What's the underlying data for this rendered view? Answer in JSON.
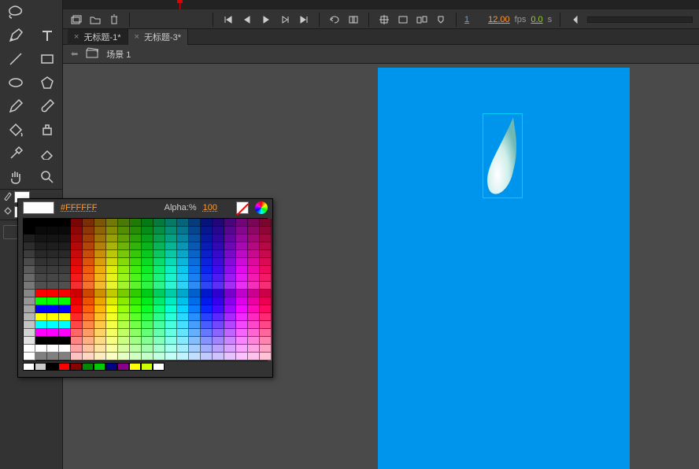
{
  "playback": {
    "frame": "1",
    "fps_value": "12.00",
    "fps_label": "fps",
    "time_value": "0.0",
    "time_label": "s"
  },
  "tabs": [
    {
      "label": "无标题-1*",
      "active": false
    },
    {
      "label": "无标题-3*",
      "active": true
    }
  ],
  "breadcrumb": {
    "scene_label": "场景 1"
  },
  "color_picker": {
    "hex": "#FFFFFF",
    "alpha_label": "Alpha:%",
    "alpha_value": "100"
  },
  "swatches": {
    "stroke": "#000000",
    "fill": "#FFFFFF"
  },
  "stage": {
    "bg_color": "#0095ed"
  }
}
